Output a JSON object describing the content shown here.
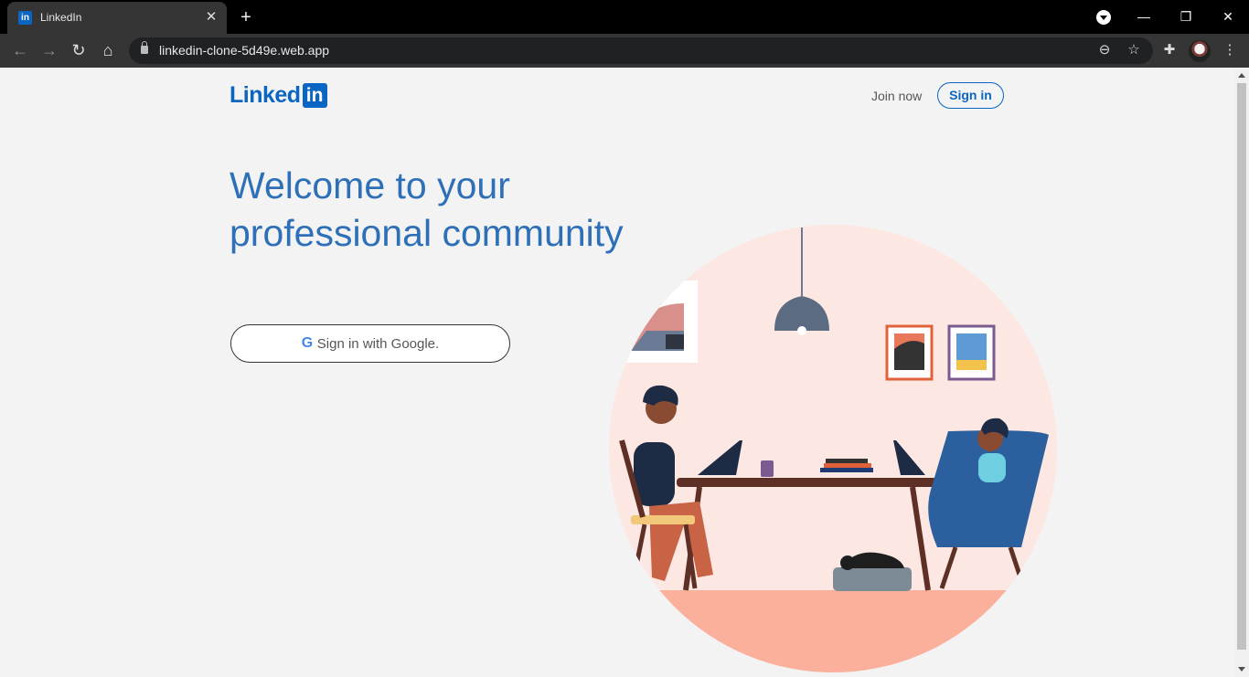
{
  "browser": {
    "tab": {
      "favicon": "in",
      "title": "LinkedIn"
    },
    "new_tab": "+",
    "url": "linkedin-clone-5d49e.web.app",
    "window_controls": {
      "minimize": "—",
      "restore": "❐",
      "close": "✕"
    }
  },
  "header": {
    "logo_text": "Linked",
    "logo_box": "in",
    "join_now": "Join now",
    "sign_in": "Sign in"
  },
  "hero": {
    "headline_line1": "Welcome to your",
    "headline_line2": "professional community",
    "google_icon": "G",
    "google_button": "Sign in with Google."
  },
  "colors": {
    "brand": "#0a66c2",
    "headline": "#2e70b8",
    "illustration_bg": "#fde7e2",
    "floor": "#fbb09b"
  }
}
